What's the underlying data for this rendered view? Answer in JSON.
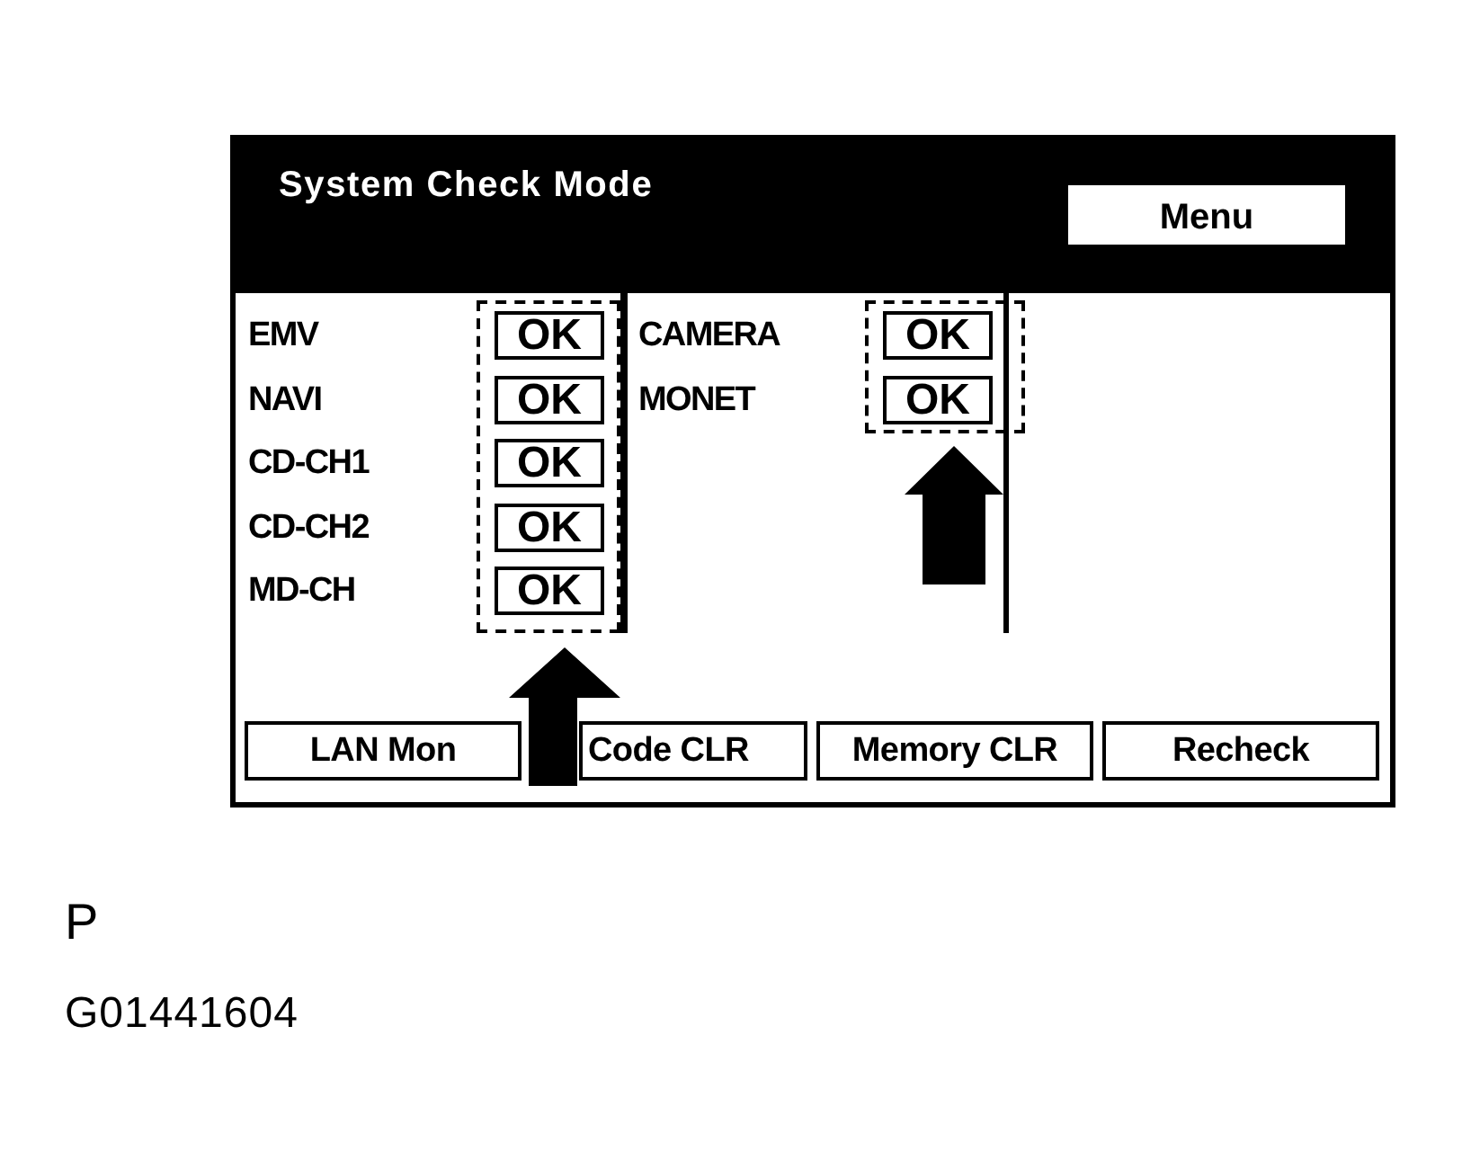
{
  "screen": {
    "title": "System Check Mode",
    "menu_button": "Menu",
    "column_1": [
      {
        "label": "EMV",
        "result": "OK"
      },
      {
        "label": "NAVI",
        "result": "OK"
      },
      {
        "label": "CD-CH1",
        "result": "OK"
      },
      {
        "label": "CD-CH2",
        "result": "OK"
      },
      {
        "label": "MD-CH",
        "result": "OK"
      }
    ],
    "column_2": [
      {
        "label": "CAMERA",
        "result": "OK"
      },
      {
        "label": "MONET",
        "result": "OK"
      }
    ],
    "buttons": [
      "LAN Mon",
      "Code CLR",
      "Memory CLR",
      "Recheck"
    ]
  },
  "figure_mark": "P",
  "figure_code": "G01441604"
}
